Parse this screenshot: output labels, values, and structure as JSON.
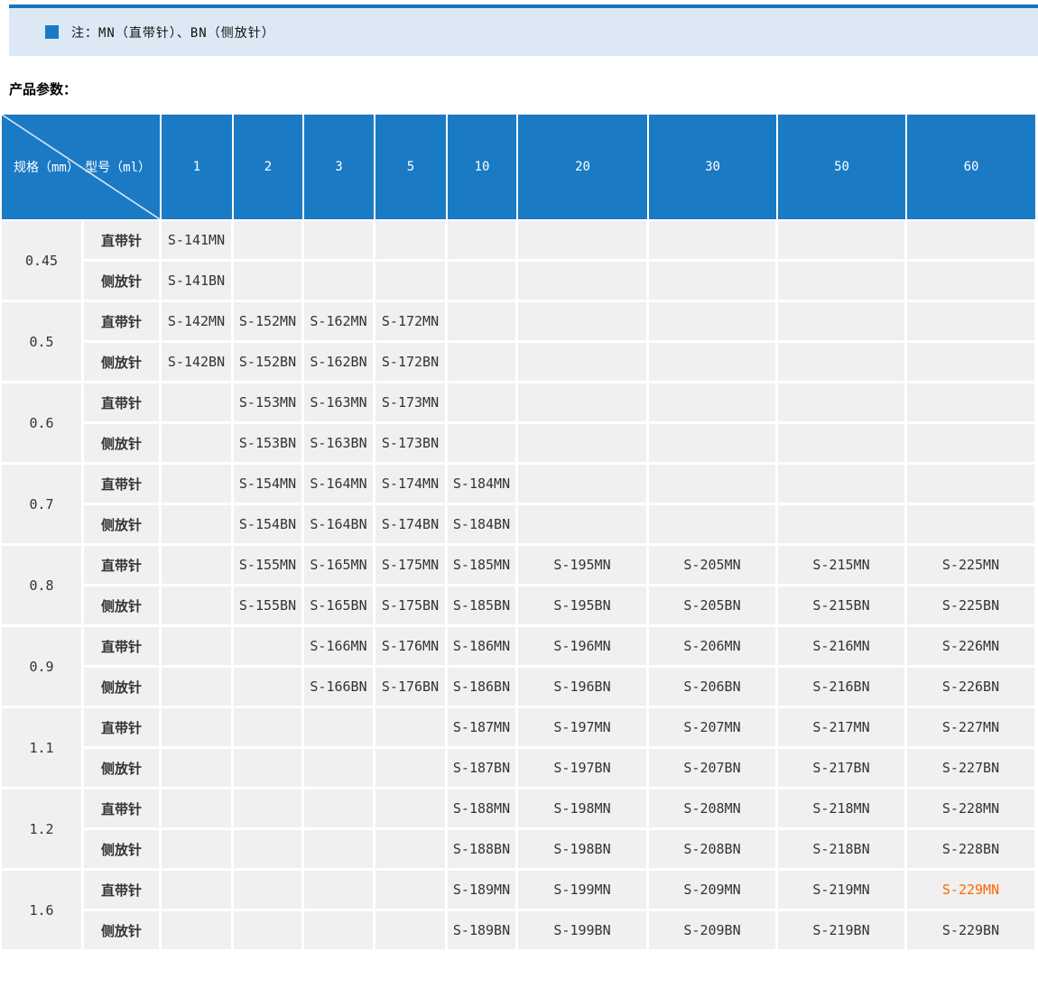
{
  "note": {
    "text": "注：MN（直带针）、BN（侧放针）"
  },
  "section_title": "产品参数：",
  "colors": {
    "header_bg": "#1a7ac4",
    "banner_bg": "#dce9f5",
    "banner_line": "#1b74ba",
    "cell_bg": "#f0f0f0",
    "highlight": "#ff6600"
  },
  "table": {
    "corner": {
      "spec_label": "规格（mm）",
      "model_label": "型号（ml）"
    },
    "columns": [
      "1",
      "2",
      "3",
      "5",
      "10",
      "20",
      "30",
      "50",
      "60"
    ],
    "row_type_labels": [
      "直带针",
      "侧放针"
    ],
    "groups": [
      {
        "spec": "0.45",
        "mn": [
          "S-141MN",
          "",
          "",
          "",
          "",
          "",
          "",
          "",
          ""
        ],
        "bn": [
          "S-141BN",
          "",
          "",
          "",
          "",
          "",
          "",
          "",
          ""
        ]
      },
      {
        "spec": "0.5",
        "mn": [
          "S-142MN",
          "S-152MN",
          "S-162MN",
          "S-172MN",
          "",
          "",
          "",
          "",
          ""
        ],
        "bn": [
          "S-142BN",
          "S-152BN",
          "S-162BN",
          "S-172BN",
          "",
          "",
          "",
          "",
          ""
        ]
      },
      {
        "spec": "0.6",
        "mn": [
          "",
          "S-153MN",
          "S-163MN",
          "S-173MN",
          "",
          "",
          "",
          "",
          ""
        ],
        "bn": [
          "",
          "S-153BN",
          "S-163BN",
          "S-173BN",
          "",
          "",
          "",
          "",
          ""
        ]
      },
      {
        "spec": "0.7",
        "mn": [
          "",
          "S-154MN",
          "S-164MN",
          "S-174MN",
          "S-184MN",
          "",
          "",
          "",
          ""
        ],
        "bn": [
          "",
          "S-154BN",
          "S-164BN",
          "S-174BN",
          "S-184BN",
          "",
          "",
          "",
          ""
        ]
      },
      {
        "spec": "0.8",
        "mn": [
          "",
          "S-155MN",
          "S-165MN",
          "S-175MN",
          "S-185MN",
          "S-195MN",
          "S-205MN",
          "S-215MN",
          "S-225MN"
        ],
        "bn": [
          "",
          "S-155BN",
          "S-165BN",
          "S-175BN",
          "S-185BN",
          "S-195BN",
          "S-205BN",
          "S-215BN",
          "S-225BN"
        ]
      },
      {
        "spec": "0.9",
        "mn": [
          "",
          "",
          "S-166MN",
          "S-176MN",
          "S-186MN",
          "S-196MN",
          "S-206MN",
          "S-216MN",
          "S-226MN"
        ],
        "bn": [
          "",
          "",
          "S-166BN",
          "S-176BN",
          "S-186BN",
          "S-196BN",
          "S-206BN",
          "S-216BN",
          "S-226BN"
        ]
      },
      {
        "spec": "1.1",
        "mn": [
          "",
          "",
          "",
          "",
          "S-187MN",
          "S-197MN",
          "S-207MN",
          "S-217MN",
          "S-227MN"
        ],
        "bn": [
          "",
          "",
          "",
          "",
          "S-187BN",
          "S-197BN",
          "S-207BN",
          "S-217BN",
          "S-227BN"
        ]
      },
      {
        "spec": "1.2",
        "mn": [
          "",
          "",
          "",
          "",
          "S-188MN",
          "S-198MN",
          "S-208MN",
          "S-218MN",
          "S-228MN"
        ],
        "bn": [
          "",
          "",
          "",
          "",
          "S-188BN",
          "S-198BN",
          "S-208BN",
          "S-218BN",
          "S-228BN"
        ]
      },
      {
        "spec": "1.6",
        "mn": [
          "",
          "",
          "",
          "",
          "S-189MN",
          "S-199MN",
          "S-209MN",
          "S-219MN",
          "S-229MN"
        ],
        "bn": [
          "",
          "",
          "",
          "",
          "S-189BN",
          "S-199BN",
          "S-209BN",
          "S-219BN",
          "S-229BN"
        ]
      }
    ],
    "highlight": {
      "group_index": 8,
      "row": "mn",
      "col_index": 8,
      "value": "S-229MN",
      "color": "#ff6600"
    }
  }
}
